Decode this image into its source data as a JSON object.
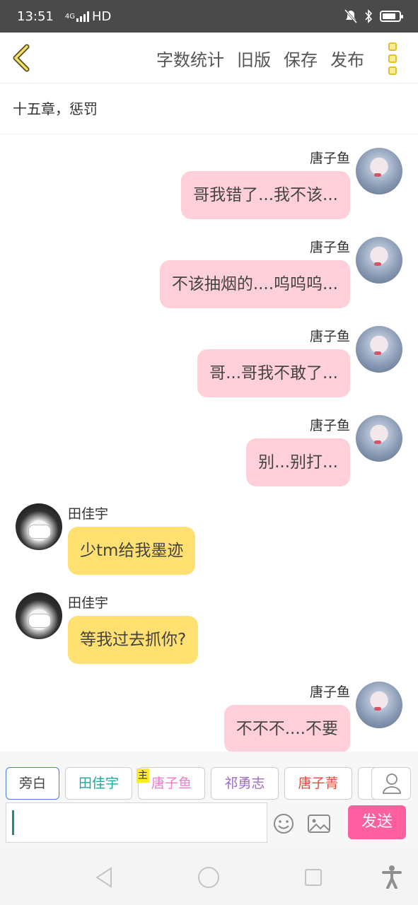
{
  "status_bar": {
    "time": "13:51",
    "network": "4G",
    "hd": "HD",
    "battery_level": 0.8
  },
  "toolbar": {
    "word_count": "字数统计",
    "old_version": "旧版",
    "save": "保存",
    "publish": "发布"
  },
  "chapter_title": "十五章，惩罚",
  "messages": [
    {
      "side": "right",
      "name": "唐子鱼",
      "text": "哥我错了...我不该..."
    },
    {
      "side": "right",
      "name": "唐子鱼",
      "text": "不该抽烟的....呜呜呜..."
    },
    {
      "side": "right",
      "name": "唐子鱼",
      "text": "哥...哥我不敢了..."
    },
    {
      "side": "right",
      "name": "唐子鱼",
      "text": "别...别打..."
    },
    {
      "side": "left",
      "name": "田佳宇",
      "text": "少tm给我墨迹"
    },
    {
      "side": "left",
      "name": "田佳宇",
      "text": "等我过去抓你?"
    },
    {
      "side": "right",
      "name": "唐子鱼",
      "text": "不不不....不要"
    }
  ],
  "roles": [
    {
      "label": "旁白",
      "color": "#444444",
      "active": true
    },
    {
      "label": "田佳宇",
      "color": "#1aa99a",
      "active": false
    },
    {
      "label": "唐子鱼",
      "color": "#f47ac9",
      "active": false
    },
    {
      "label": "祁勇志",
      "color": "#9b68c9",
      "active": false
    },
    {
      "label": "唐子菁",
      "color": "#e8493c",
      "active": false
    }
  ],
  "main_tag": "主",
  "composer": {
    "input_value": "",
    "send_label": "发送"
  }
}
